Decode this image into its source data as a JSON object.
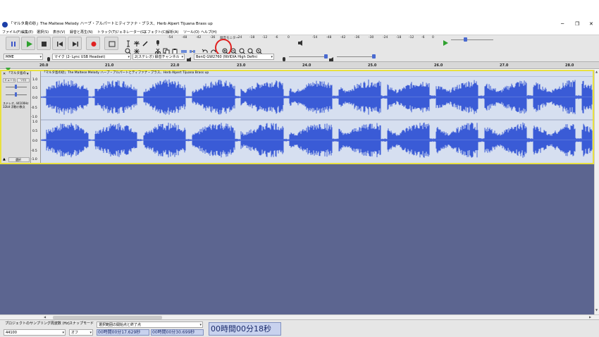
{
  "window": {
    "title": "「マルタ島の砂」The Maltese Melody ハーブ・アルパートとティファナ・ブラス、Herb Alpert Tijuana Brass up",
    "controls": [
      "─",
      "❐",
      "✕"
    ]
  },
  "menu": [
    "ファイル(F)",
    "編集(E)",
    "選択(S)",
    "表示(V)",
    "録音と再生(N)",
    "トラック(T)",
    "ジェネレーター(G)",
    "エフェクト(C)",
    "解析(A)",
    "ツール(O)",
    "ヘルプ(H)"
  ],
  "meters": {
    "record_label": "録音モニター",
    "record_ticks": [
      "-54",
      "-48",
      "-42",
      "-36",
      "-30",
      "-24",
      "-18",
      "-12",
      "-6",
      "0"
    ],
    "play_ticks": [
      "-54",
      "-48",
      "-42",
      "-36",
      "-30",
      "-24",
      "-18",
      "-12",
      "-6",
      "0"
    ]
  },
  "device": {
    "host": "MME",
    "mic": "マイク (2- Lync USB Headset)",
    "channels": "2(ステレオ) 録音チャンネル",
    "output": "BenQ GW2760 (NVIDIA High Defini"
  },
  "ruler": {
    "ticks": [
      "20.0",
      "21.0",
      "22.0",
      "23.0",
      "24.0",
      "25.0",
      "26.0",
      "27.0",
      "28.0"
    ]
  },
  "track": {
    "name": "「マルタ島の",
    "clip_title": "「マルタ島の砂」The Maltese Melody ハーブ・アルパートとティファナ・ブラス、Herb Alpert Tijuana Brass up",
    "mute": "ミュート",
    "solo": "ソロ",
    "info": "ステレオ, 44100Hz\n32bit 浮動小数点",
    "select": "選択",
    "scale": [
      "1.0",
      "0.5",
      "0.0",
      "-0.5",
      "-1.0"
    ]
  },
  "status": {
    "rate_label": "プロジェクトのサンプリング周波数 (Hz)",
    "rate_value": "44100",
    "snap_label": "スナップモード",
    "snap_value": "オフ",
    "selection_label": "選択範囲の開始点と終了点",
    "sel_start": "00時間00分17.629秒",
    "sel_end": "00時間00分30.699秒",
    "position": "00時間00分18秒"
  },
  "colors": {
    "waveform": "#3a5bd6",
    "track_bg": "#d6dff0",
    "empty_area": "#5c6590",
    "highlight_circle": "#e0201f",
    "selection_border": "#e8e040"
  }
}
